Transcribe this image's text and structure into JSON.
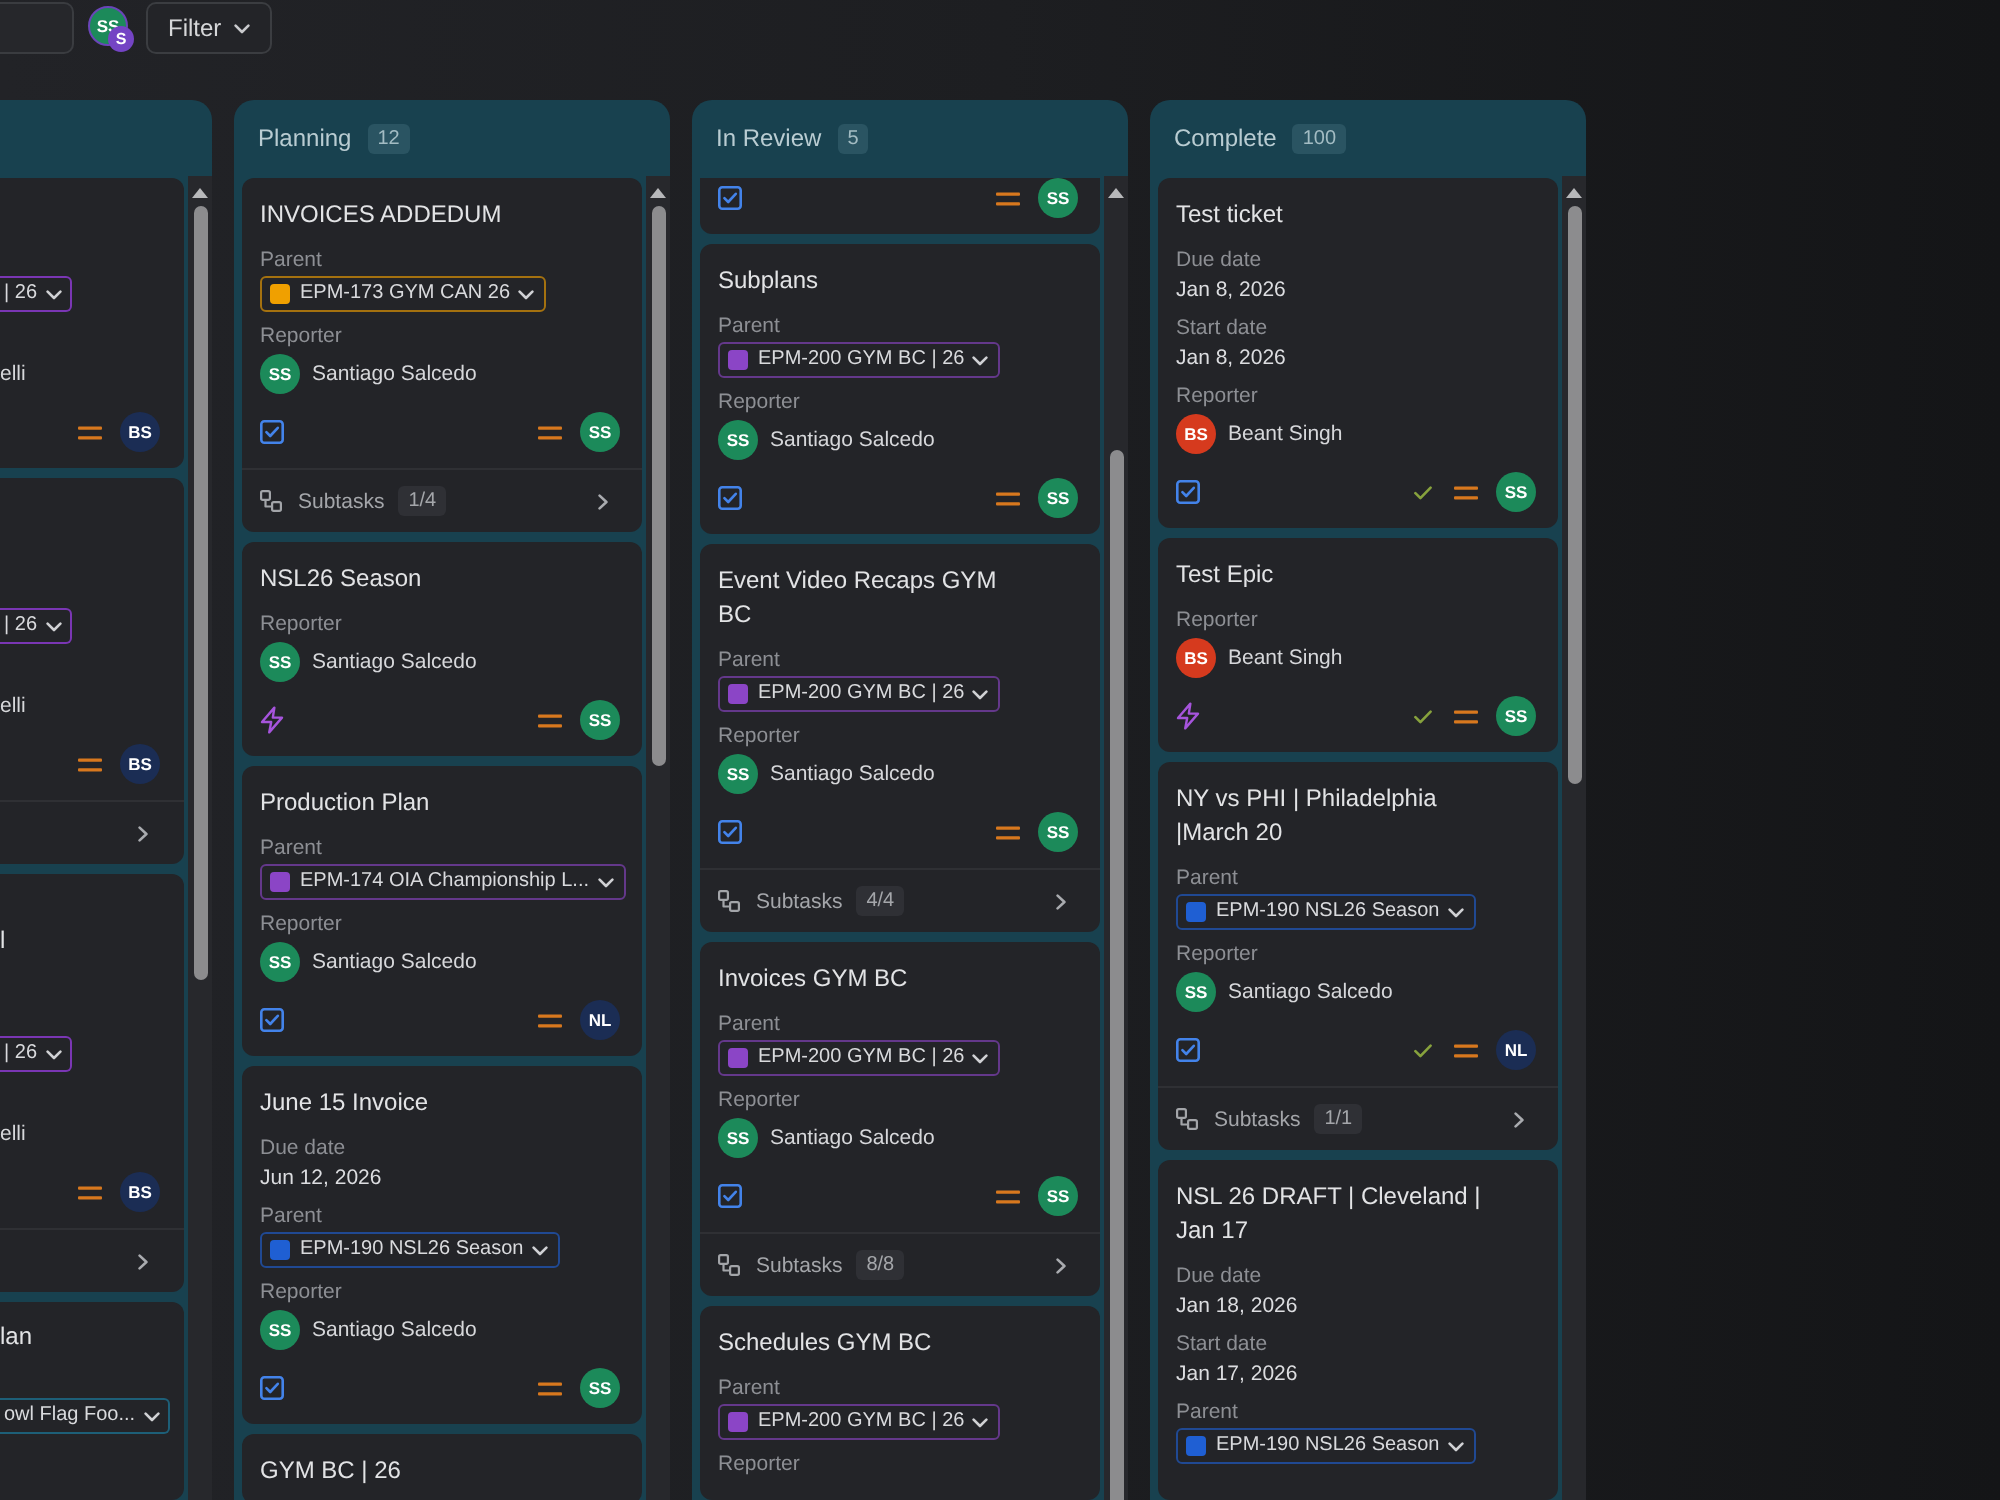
{
  "toolbar": {
    "avatar": {
      "initials": "SS",
      "color": "#1c8a5a",
      "badge": {
        "initials": "S",
        "color": "#7444c4"
      }
    },
    "filter": {
      "label": "Filter"
    }
  },
  "clipped_column": {
    "cards": [
      {
        "parent": {
          "text": "| 26",
          "color": "#7a36b4"
        },
        "reporter": "elli",
        "assignee": {
          "initials": "BS",
          "color": "#1b2d54"
        },
        "subtasks_row": false
      },
      {
        "parent": {
          "text": "| 26",
          "color": "#7a36b4"
        },
        "reporter": "elli",
        "assignee": {
          "initials": "BS",
          "color": "#1b2d54"
        },
        "subtasks_row": true
      },
      {
        "title": "l",
        "parent": {
          "text": "| 26",
          "color": "#7a36b4"
        },
        "reporter": "elli",
        "assignee": {
          "initials": "BS",
          "color": "#1b2d54"
        },
        "subtasks_row": true
      },
      {
        "title": "lan",
        "parent": {
          "text": "owl Flag Foo...",
          "color": "#1d5f78"
        },
        "subtasks_row": false
      }
    ]
  },
  "columns": [
    {
      "title": "Planning",
      "count": "12",
      "cards": [
        {
          "kind": "task",
          "title": "INVOICES ADDEDUM",
          "fields": [
            {
              "kind": "parent",
              "label": "Parent",
              "chip": "EPM-173 GYM CAN 26",
              "color": "#f0a000"
            },
            {
              "kind": "reporter",
              "label": "Reporter",
              "initials": "SS",
              "name": "Santiago Salcedo",
              "color": "#1c8a5a"
            }
          ],
          "footer": {
            "done": false,
            "assignee": {
              "initials": "SS",
              "color": "#1c8a5a"
            }
          },
          "subtasks": {
            "label": "Subtasks",
            "count": "1/4"
          }
        },
        {
          "kind": "epic",
          "title": "NSL26 Season",
          "fields": [
            {
              "kind": "reporter",
              "label": "Reporter",
              "initials": "SS",
              "name": "Santiago Salcedo",
              "color": "#1c8a5a"
            }
          ],
          "footer": {
            "done": false,
            "assignee": {
              "initials": "SS",
              "color": "#1c8a5a"
            }
          }
        },
        {
          "kind": "task",
          "title": "Production Plan",
          "fields": [
            {
              "kind": "parent",
              "label": "Parent",
              "chip": "EPM-174 OIA Championship L...",
              "color": "#8b45c6"
            },
            {
              "kind": "reporter",
              "label": "Reporter",
              "initials": "SS",
              "name": "Santiago Salcedo",
              "color": "#1c8a5a"
            }
          ],
          "footer": {
            "done": false,
            "assignee": {
              "initials": "NL",
              "color": "#1b2d54"
            }
          }
        },
        {
          "kind": "task",
          "title": "June 15 Invoice",
          "fields": [
            {
              "kind": "date",
              "label": "Due date",
              "value": "Jun 12, 2026"
            },
            {
              "kind": "parent",
              "label": "Parent",
              "chip": "EPM-190 NSL26 Season",
              "color": "#1f5fd3"
            },
            {
              "kind": "reporter",
              "label": "Reporter",
              "initials": "SS",
              "name": "Santiago Salcedo",
              "color": "#1c8a5a"
            }
          ],
          "footer": {
            "done": false,
            "assignee": {
              "initials": "SS",
              "color": "#1c8a5a"
            }
          }
        },
        {
          "title": "GYM BC | 26"
        }
      ]
    },
    {
      "title": "In Review",
      "count": "5",
      "cards": [
        {
          "kind": "task",
          "footer": {
            "done": false,
            "assignee": {
              "initials": "SS",
              "color": "#1c8a5a"
            }
          }
        },
        {
          "kind": "task",
          "title": "Subplans",
          "fields": [
            {
              "kind": "parent",
              "label": "Parent",
              "chip": "EPM-200 GYM BC | 26",
              "color": "#8b45c6"
            },
            {
              "kind": "reporter",
              "label": "Reporter",
              "initials": "SS",
              "name": "Santiago Salcedo",
              "color": "#1c8a5a"
            }
          ],
          "footer": {
            "done": false,
            "assignee": {
              "initials": "SS",
              "color": "#1c8a5a"
            }
          }
        },
        {
          "kind": "task",
          "title": "Event Video Recaps GYM BC",
          "fields": [
            {
              "kind": "parent",
              "label": "Parent",
              "chip": "EPM-200 GYM BC | 26",
              "color": "#8b45c6"
            },
            {
              "kind": "reporter",
              "label": "Reporter",
              "initials": "SS",
              "name": "Santiago Salcedo",
              "color": "#1c8a5a"
            }
          ],
          "footer": {
            "done": false,
            "assignee": {
              "initials": "SS",
              "color": "#1c8a5a"
            }
          },
          "subtasks": {
            "label": "Subtasks",
            "count": "4/4"
          }
        },
        {
          "kind": "task",
          "title": "Invoices GYM BC",
          "fields": [
            {
              "kind": "parent",
              "label": "Parent",
              "chip": "EPM-200 GYM BC | 26",
              "color": "#8b45c6"
            },
            {
              "kind": "reporter",
              "label": "Reporter",
              "initials": "SS",
              "name": "Santiago Salcedo",
              "color": "#1c8a5a"
            }
          ],
          "footer": {
            "done": false,
            "assignee": {
              "initials": "SS",
              "color": "#1c8a5a"
            }
          },
          "subtasks": {
            "label": "Subtasks",
            "count": "8/8"
          }
        },
        {
          "title": "Schedules GYM BC",
          "fields": [
            {
              "kind": "parent",
              "label": "Parent",
              "chip": "EPM-200 GYM BC | 26",
              "color": "#8b45c6"
            },
            {
              "kind": "reporter",
              "label": "Reporter"
            }
          ]
        }
      ]
    },
    {
      "title": "Complete",
      "count": "100",
      "cards": [
        {
          "kind": "task",
          "title": "Test ticket",
          "fields": [
            {
              "kind": "date",
              "label": "Due date",
              "value": "Jan 8, 2026"
            },
            {
              "kind": "date",
              "label": "Start date",
              "value": "Jan 8, 2026"
            },
            {
              "kind": "reporter",
              "label": "Reporter",
              "initials": "BS",
              "name": "Beant Singh",
              "color": "#d63a1e"
            }
          ],
          "footer": {
            "done": true,
            "assignee": {
              "initials": "SS",
              "color": "#1c8a5a"
            }
          }
        },
        {
          "kind": "epic",
          "title": "Test Epic",
          "fields": [
            {
              "kind": "reporter",
              "label": "Reporter",
              "initials": "BS",
              "name": "Beant Singh",
              "color": "#d63a1e"
            }
          ],
          "footer": {
            "done": true,
            "assignee": {
              "initials": "SS",
              "color": "#1c8a5a"
            }
          }
        },
        {
          "kind": "task",
          "title": "NY vs PHI | Philadelphia |March 20",
          "fields": [
            {
              "kind": "parent",
              "label": "Parent",
              "chip": "EPM-190 NSL26 Season",
              "color": "#1f5fd3"
            },
            {
              "kind": "reporter",
              "label": "Reporter",
              "initials": "SS",
              "name": "Santiago Salcedo",
              "color": "#1c8a5a"
            }
          ],
          "footer": {
            "done": true,
            "assignee": {
              "initials": "NL",
              "color": "#1b2d54"
            }
          },
          "subtasks": {
            "label": "Subtasks",
            "count": "1/1"
          }
        },
        {
          "title": "NSL 26 DRAFT | Cleveland | Jan 17",
          "fields": [
            {
              "kind": "date",
              "label": "Due date",
              "value": "Jan 18, 2026"
            },
            {
              "kind": "date",
              "label": "Start date",
              "value": "Jan 17, 2026"
            },
            {
              "kind": "parent",
              "label": "Parent",
              "chip": "EPM-190 NSL26 Season",
              "color": "#1f5fd3"
            }
          ]
        }
      ]
    }
  ]
}
